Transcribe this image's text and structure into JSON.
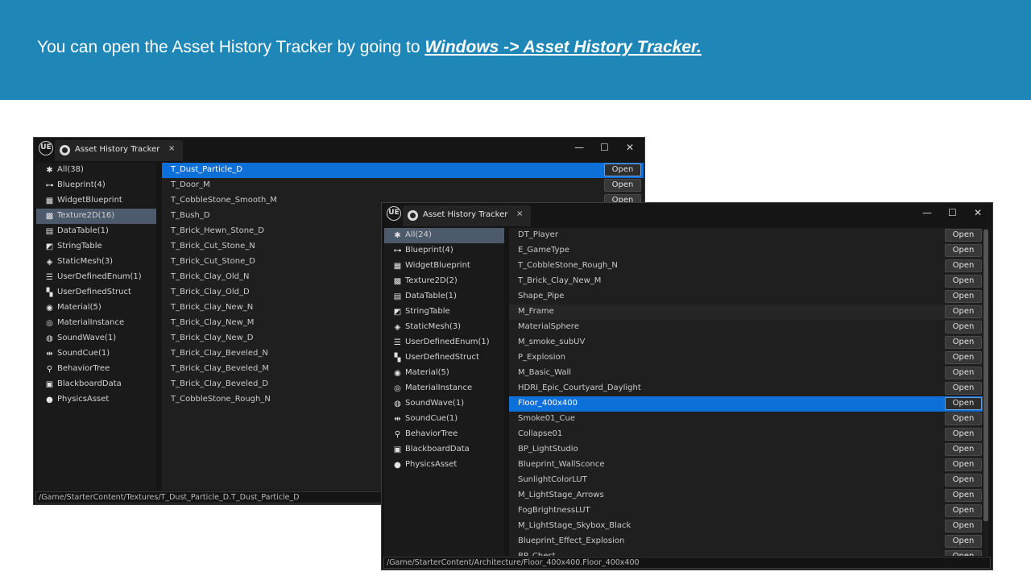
{
  "banner": {
    "text": "You can open the Asset History Tracker by going to",
    "link": "Windows -> Asset History Tracker."
  },
  "window1": {
    "logo": "UE",
    "tab_title": "Asset History Tracker",
    "tab_close": "×",
    "minimize": "—",
    "maximize": "☐",
    "close": "✕",
    "sidebar": [
      {
        "label": "All(38)",
        "icon": "asterisk-icon",
        "glyph": "✱"
      },
      {
        "label": "Blueprint(4)",
        "icon": "blueprint-icon",
        "glyph": "⊶"
      },
      {
        "label": "WidgetBlueprint",
        "icon": "widget-blueprint-icon",
        "glyph": "▦"
      },
      {
        "label": "Texture2D(16)",
        "icon": "texture-icon",
        "glyph": "▩",
        "selected": true
      },
      {
        "label": "DataTable(1)",
        "icon": "datatable-icon",
        "glyph": "▤"
      },
      {
        "label": "StringTable",
        "icon": "stringtable-icon",
        "glyph": "◩"
      },
      {
        "label": "StaticMesh(3)",
        "icon": "staticmesh-icon",
        "glyph": "◈"
      },
      {
        "label": "UserDefinedEnum(1)",
        "icon": "enum-icon",
        "glyph": "☰"
      },
      {
        "label": "UserDefinedStruct",
        "icon": "struct-icon",
        "glyph": "▚"
      },
      {
        "label": "Material(5)",
        "icon": "material-icon",
        "glyph": "◉"
      },
      {
        "label": "MaterialInstance",
        "icon": "material-instance-icon",
        "glyph": "◎"
      },
      {
        "label": "SoundWave(1)",
        "icon": "soundwave-icon",
        "glyph": "◍"
      },
      {
        "label": "SoundCue(1)",
        "icon": "soundcue-icon",
        "glyph": "⇹"
      },
      {
        "label": "BehaviorTree",
        "icon": "behaviortree-icon",
        "glyph": "⚲"
      },
      {
        "label": "BlackboardData",
        "icon": "blackboard-icon",
        "glyph": "▣"
      },
      {
        "label": "PhysicsAsset",
        "icon": "physics-icon",
        "glyph": "●"
      }
    ],
    "open_label": "Open",
    "rows": [
      "T_Dust_Particle_D",
      "T_Door_M",
      "T_CobbleStone_Smooth_M",
      "T_Bush_D",
      "T_Brick_Hewn_Stone_D",
      "T_Brick_Cut_Stone_N",
      "T_Brick_Cut_Stone_D",
      "T_Brick_Clay_Old_N",
      "T_Brick_Clay_Old_D",
      "T_Brick_Clay_New_N",
      "T_Brick_Clay_New_M",
      "T_Brick_Clay_New_D",
      "T_Brick_Clay_Beveled_N",
      "T_Brick_Clay_Beveled_M",
      "T_Brick_Clay_Beveled_D",
      "T_CobbleStone_Rough_N"
    ],
    "selected_row": 0,
    "open_buttons_visible": 3,
    "status_path": "/Game/StarterContent/Textures/T_Dust_Particle_D.T_Dust_Particle_D"
  },
  "window2": {
    "logo": "UE",
    "tab_title": "Asset History Tracker",
    "tab_close": "×",
    "minimize": "—",
    "maximize": "☐",
    "close": "✕",
    "sidebar": [
      {
        "label": "All(24)",
        "icon": "asterisk-icon",
        "glyph": "✱",
        "selected": true
      },
      {
        "label": "Blueprint(4)",
        "icon": "blueprint-icon",
        "glyph": "⊶"
      },
      {
        "label": "WidgetBlueprint",
        "icon": "widget-blueprint-icon",
        "glyph": "▦"
      },
      {
        "label": "Texture2D(2)",
        "icon": "texture-icon",
        "glyph": "▩"
      },
      {
        "label": "DataTable(1)",
        "icon": "datatable-icon",
        "glyph": "▤"
      },
      {
        "label": "StringTable",
        "icon": "stringtable-icon",
        "glyph": "◩"
      },
      {
        "label": "StaticMesh(3)",
        "icon": "staticmesh-icon",
        "glyph": "◈"
      },
      {
        "label": "UserDefinedEnum(1)",
        "icon": "enum-icon",
        "glyph": "☰"
      },
      {
        "label": "UserDefinedStruct",
        "icon": "struct-icon",
        "glyph": "▚"
      },
      {
        "label": "Material(5)",
        "icon": "material-icon",
        "glyph": "◉"
      },
      {
        "label": "MaterialInstance",
        "icon": "material-instance-icon",
        "glyph": "◎"
      },
      {
        "label": "SoundWave(1)",
        "icon": "soundwave-icon",
        "glyph": "◍"
      },
      {
        "label": "SoundCue(1)",
        "icon": "soundcue-icon",
        "glyph": "⇹"
      },
      {
        "label": "BehaviorTree",
        "icon": "behaviortree-icon",
        "glyph": "⚲"
      },
      {
        "label": "BlackboardData",
        "icon": "blackboard-icon",
        "glyph": "▣"
      },
      {
        "label": "PhysicsAsset",
        "icon": "physics-icon",
        "glyph": "●"
      }
    ],
    "open_label": "Open",
    "rows": [
      "DT_Player",
      "E_GameType",
      "T_CobbleStone_Rough_N",
      "T_Brick_Clay_New_M",
      "Shape_Pipe",
      "M_Frame",
      "MaterialSphere",
      "M_smoke_subUV",
      "P_Explosion",
      "M_Basic_Wall",
      "HDRI_Epic_Courtyard_Daylight",
      "Floor_400x400",
      "Smoke01_Cue",
      "Collapse01",
      "BP_LightStudio",
      "Blueprint_WallSconce",
      "SunlightColorLUT",
      "M_LightStage_Arrows",
      "FogBrightnessLUT",
      "M_LightStage_Skybox_Black",
      "Blueprint_Effect_Explosion",
      "BP_Chest"
    ],
    "selected_row": 11,
    "hover_row": 5,
    "status_path": "/Game/StarterContent/Architecture/Floor_400x400.Floor_400x400"
  }
}
